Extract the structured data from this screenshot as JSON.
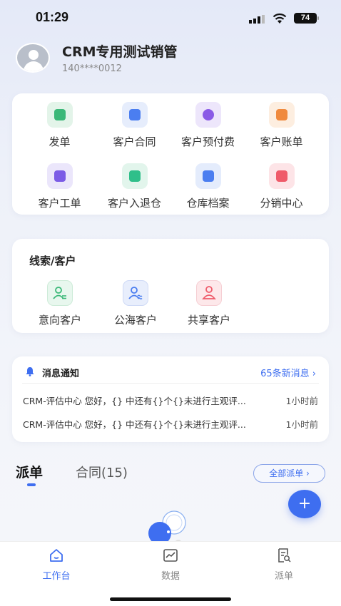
{
  "status_bar": {
    "time": "01:29",
    "battery": "74"
  },
  "profile": {
    "name": "CRM专用测试销管",
    "phone": "140****0012"
  },
  "features": [
    {
      "label": "发单",
      "icon": "order-dispatch-icon",
      "color": "#3bb878",
      "bg": "#e6f6ec"
    },
    {
      "label": "客户合同",
      "icon": "contract-icon",
      "color": "#4b7ef0",
      "bg": "#e8eefc"
    },
    {
      "label": "客户预付费",
      "icon": "prepaid-icon",
      "color": "#8a5be6",
      "bg": "#efe8fb"
    },
    {
      "label": "客户账单",
      "icon": "bill-icon",
      "color": "#f08a3e",
      "bg": "#fdf0e4"
    },
    {
      "label": "客户工单",
      "icon": "work-order-icon",
      "color": "#7b5be6",
      "bg": "#ece8fb"
    },
    {
      "label": "客户入退仓",
      "icon": "warehouse-inout-icon",
      "color": "#2fbf8a",
      "bg": "#e4f6ee"
    },
    {
      "label": "仓库档案",
      "icon": "warehouse-archive-icon",
      "color": "#4b7ef0",
      "bg": "#e6eefc"
    },
    {
      "label": "分销中心",
      "icon": "distribution-icon",
      "color": "#ef5b6a",
      "bg": "#fde6e9"
    }
  ],
  "leads": {
    "title": "线索/客户",
    "items": [
      {
        "label": "意向客户",
        "icon": "intent-customer-icon",
        "color": "#3bb878",
        "bg": "#e8f7ee"
      },
      {
        "label": "公海客户",
        "icon": "public-pool-customer-icon",
        "color": "#4b7ef0",
        "bg": "#e8eefc"
      },
      {
        "label": "共享客户",
        "icon": "shared-customer-icon",
        "color": "#ef5b6a",
        "bg": "#fde8ea"
      }
    ]
  },
  "messages": {
    "title": "消息通知",
    "more": "65条新消息",
    "items": [
      {
        "text": "CRM-评估中心 您好，{} 中还有{}个{}未进行主观评...",
        "time": "1小时前"
      },
      {
        "text": "CRM-评估中心 您好，{} 中还有{}个{}未进行主观评...",
        "time": "1小时前"
      }
    ]
  },
  "tabs": {
    "active": "派单",
    "second": "合同(15)",
    "all_button": "全部派单 ›"
  },
  "fab": "+",
  "bottom_nav": [
    {
      "label": "工作台",
      "icon": "home-icon",
      "active": true
    },
    {
      "label": "数据",
      "icon": "chart-icon",
      "active": false
    },
    {
      "label": "派单",
      "icon": "dispatch-list-icon",
      "active": false
    }
  ],
  "accent": "#3e6ef0"
}
